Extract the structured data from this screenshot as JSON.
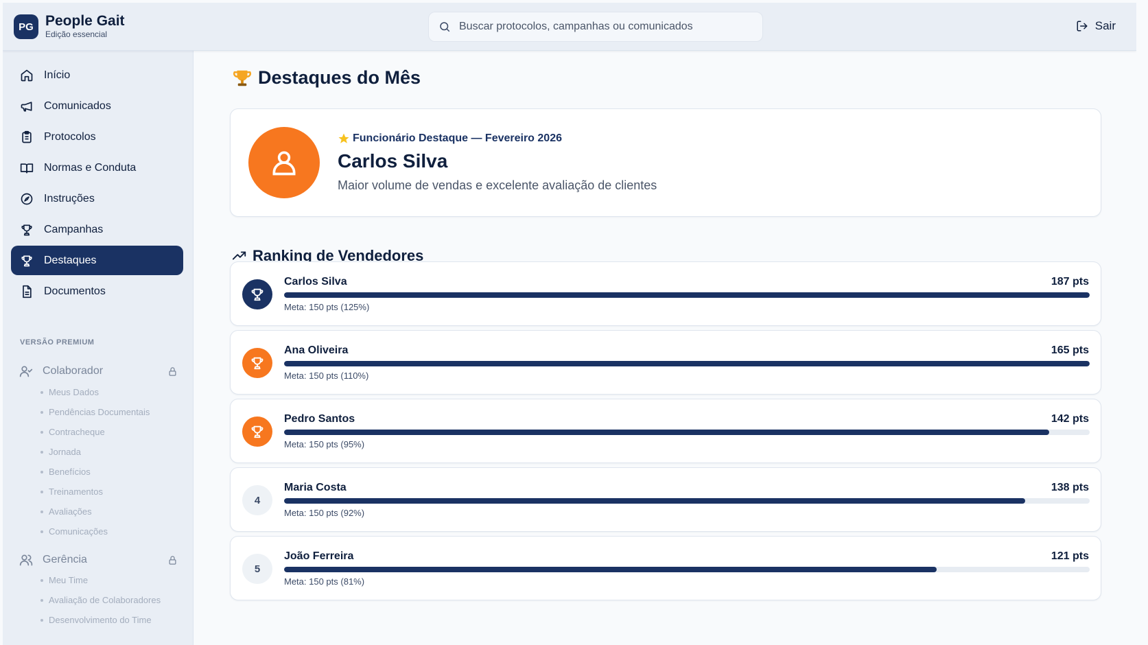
{
  "header": {
    "brand_initials": "PG",
    "brand_name": "People Gait",
    "brand_sub": "Edição essencial",
    "search_placeholder": "Buscar protocolos, campanhas ou comunicados",
    "logout_label": "Sair"
  },
  "sidebar": {
    "items": [
      {
        "label": "Início",
        "icon": "home-icon"
      },
      {
        "label": "Comunicados",
        "icon": "megaphone-icon"
      },
      {
        "label": "Protocolos",
        "icon": "clipboard-icon"
      },
      {
        "label": "Normas e Conduta",
        "icon": "book-icon"
      },
      {
        "label": "Instruções",
        "icon": "compass-icon"
      },
      {
        "label": "Campanhas",
        "icon": "trophy-icon"
      },
      {
        "label": "Destaques",
        "icon": "trophy-icon",
        "active": true
      },
      {
        "label": "Documentos",
        "icon": "document-icon"
      }
    ],
    "premium_label": "VERSÃO PREMIUM",
    "groups": [
      {
        "label": "Colaborador",
        "icon": "user-check-icon",
        "locked": true,
        "items": [
          "Meus Dados",
          "Pendências Documentais",
          "Contracheque",
          "Jornada",
          "Benefícios",
          "Treinamentos",
          "Avaliações",
          "Comunicações"
        ]
      },
      {
        "label": "Gerência",
        "icon": "users-icon",
        "locked": true,
        "items": [
          "Meu Time",
          "Avaliação de Colaboradores",
          "Desenvolvimento do Time"
        ]
      }
    ]
  },
  "main": {
    "title": "Destaques do Mês",
    "hero": {
      "tag": "Funcionário Destaque — Fevereiro 2026",
      "name": "Carlos Silva",
      "description": "Maior volume de vendas e excelente avaliação de clientes"
    },
    "ranking_title": "Ranking de Vendedores",
    "ranking": [
      {
        "position": "1",
        "name": "Carlos Silva",
        "points": "187 pts",
        "meta": "Meta: 150 pts (125%)",
        "progress": 1.0,
        "badge": "gold"
      },
      {
        "position": "2",
        "name": "Ana Oliveira",
        "points": "165 pts",
        "meta": "Meta: 150 pts (110%)",
        "progress": 1.0,
        "badge": "orange"
      },
      {
        "position": "3",
        "name": "Pedro Santos",
        "points": "142 pts",
        "meta": "Meta: 150 pts (95%)",
        "progress": 0.95,
        "badge": "orange"
      },
      {
        "position": "4",
        "name": "Maria Costa",
        "points": "138 pts",
        "meta": "Meta: 150 pts (92%)",
        "progress": 0.92,
        "badge": "grey"
      },
      {
        "position": "5",
        "name": "João Ferreira",
        "points": "121 pts",
        "meta": "Meta: 150 pts (81%)",
        "progress": 0.81,
        "badge": "grey"
      }
    ]
  },
  "colors": {
    "navy": "#1a3263",
    "orange": "#f7771f",
    "sidebar_bg": "#e9eef5"
  }
}
